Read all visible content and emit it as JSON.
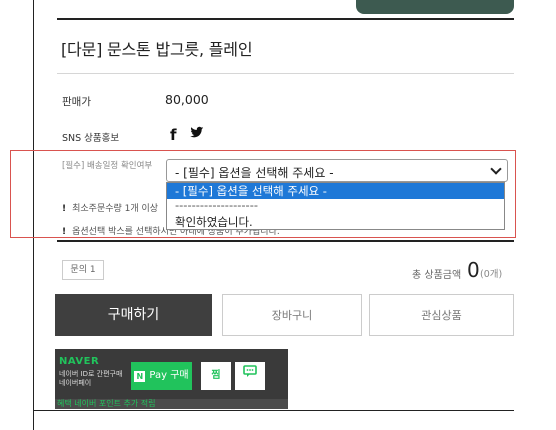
{
  "product": {
    "title": "[다문] 문스톤 밥그릇, 플레인"
  },
  "price": {
    "label": "판매가",
    "value": "80,000"
  },
  "sns": {
    "label": "SNS 상품홍보",
    "facebook_glyph": "f",
    "twitter_glyph": "🐦"
  },
  "option": {
    "label": "[필수] 배송일정 확인여부",
    "selected": "- [필수] 옵션을 선택해 주세요 -",
    "dropdown": [
      "- [필수] 옵션을 선택해 주세요 -",
      "--------------------",
      "확인하였습니다."
    ]
  },
  "notes": {
    "min_qty": "최소주문수량 1개 이상",
    "info": "옵션선택 박스를 선택하시면 아래에 상품이 추가됩니다."
  },
  "summary": {
    "qty_label": "문의 1",
    "total_label": "총 상품금액",
    "total_value": "0",
    "total_count": "(0개)"
  },
  "actions": {
    "buy": "구매하기",
    "cart": "장바구니",
    "wish": "관심상품"
  },
  "npay": {
    "brand": "NAVER",
    "sub_line1": "네이버 ID로 간편구매",
    "sub_line2": "네이버페이",
    "pay_label": "Pay 구매",
    "pay_n": "N",
    "wish_label": "찜",
    "talk_label": "💬",
    "strip_text": "혜택 네이버 포인트 추가 적립"
  }
}
